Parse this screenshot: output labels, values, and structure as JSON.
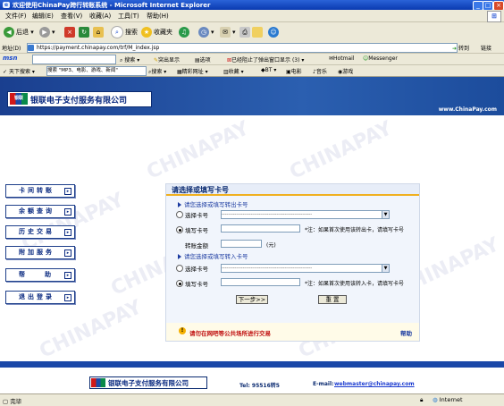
{
  "window": {
    "title": "欢迎使用ChinaPay跨行转账系统 - Microsoft Internet Explorer",
    "controls": [
      "_",
      "□",
      "×"
    ]
  },
  "menu": [
    "文件(F)",
    "编辑(E)",
    "查看(V)",
    "收藏(A)",
    "工具(T)",
    "帮助(H)"
  ],
  "toolbar": {
    "back": "后退",
    "search": "搜索",
    "favorites": "收藏夹"
  },
  "address": {
    "label": "地址(D)",
    "url": "https://payment.chinapay.com/trf/M_index.jsp",
    "go": "转到",
    "links": "链接"
  },
  "msnbar": {
    "logo": "msn",
    "search": "搜索",
    "highlight": "突出显示",
    "options": "选项",
    "popups": "已经阻止了弹出窗口显示 (3)",
    "hotmail": "Hotmail",
    "messenger": "Messenger"
  },
  "linkbar": {
    "tianxia": "天下搜索",
    "query": "搜索 \"MP3、电影、游戏、新闻\"",
    "search": "搜索",
    "jingcai": "精彩网址",
    "collect": "收藏",
    "bt": "BT",
    "movie": "电影",
    "music": "音乐",
    "game": "游戏"
  },
  "page": {
    "logo": "银联电子支付服务有限公司",
    "logo_mark": "银联",
    "site": "www.ChinaPay.com",
    "watermark": "CHINAPAY",
    "nav": [
      "卡间转账",
      "余额查询",
      "历史交易",
      "附加服务",
      "帮助",
      "退出登录"
    ],
    "form": {
      "heading": "请选择或填写卡号",
      "out_section": "请您选择或填写转出卡号",
      "in_section": "请您选择或填写转入卡号",
      "select_label": "选择卡号",
      "fill_label": "填写卡号",
      "amount_label": "转账金额",
      "amount_unit": "(元)",
      "select_placeholder": "--------------------------------------------------------",
      "out_note": "*注：如果首次使用该转出卡，请填写卡号",
      "in_note": "*注：如果首次使用该转入卡，请填写卡号",
      "next_button": "下一步>>",
      "reset_button": "重 置",
      "warning": "请勿在网吧等公共场所进行交易",
      "help": "帮助"
    },
    "footer": {
      "logo": "银联电子支付服务有限公司",
      "tel": "Tel: 95516转5",
      "email_label": "E-mail:",
      "email": "webmaster@chinapay.com"
    }
  },
  "status": {
    "text": "完毕",
    "zone": "Internet"
  }
}
